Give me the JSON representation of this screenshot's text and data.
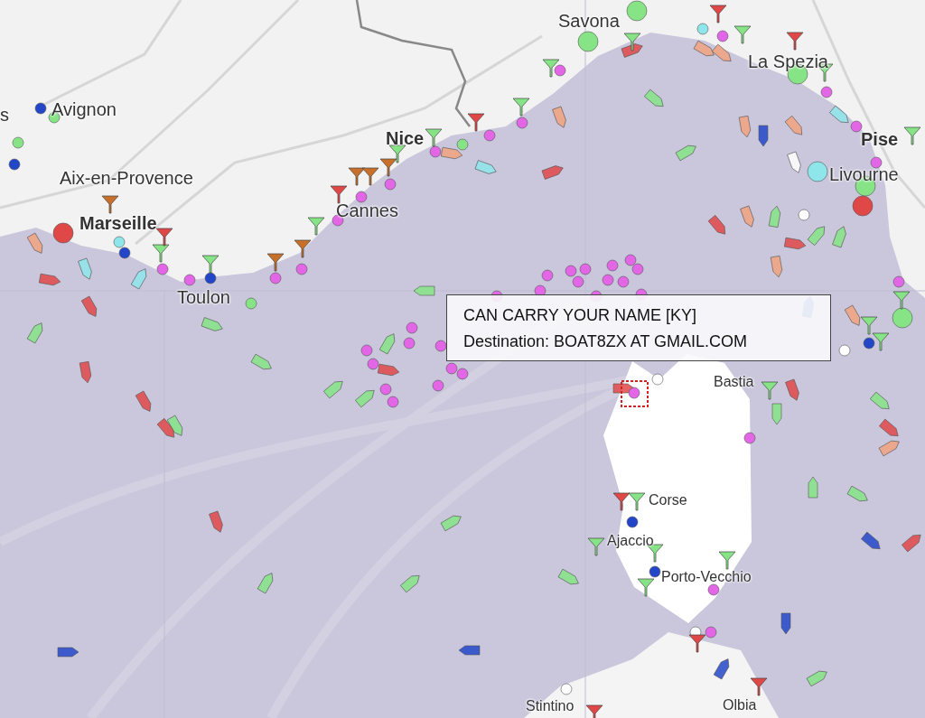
{
  "map": {
    "places": [
      {
        "name": "s",
        "kind": "city"
      },
      {
        "name": "Avignon",
        "kind": "city"
      },
      {
        "name": "Aix-en-Provence",
        "kind": "city"
      },
      {
        "name": "Marseille",
        "kind": "major"
      },
      {
        "name": "Toulon",
        "kind": "city"
      },
      {
        "name": "Cannes",
        "kind": "city"
      },
      {
        "name": "Nice",
        "kind": "major"
      },
      {
        "name": "Savona",
        "kind": "city"
      },
      {
        "name": "La Spezia",
        "kind": "city"
      },
      {
        "name": "Pise",
        "kind": "major"
      },
      {
        "name": "Livourne",
        "kind": "city"
      },
      {
        "name": "Bastia",
        "kind": "town"
      },
      {
        "name": "Corse",
        "kind": "town"
      },
      {
        "name": "Ajaccio",
        "kind": "town"
      },
      {
        "name": "Porto-Vecchio",
        "kind": "town"
      },
      {
        "name": "Stintino",
        "kind": "town"
      },
      {
        "name": "Olbia",
        "kind": "town"
      }
    ]
  },
  "tooltip": {
    "title": "CAN CARRY YOUR NAME [KY]",
    "destination": "Destination: BOAT8ZX AT GMAIL.COM"
  }
}
